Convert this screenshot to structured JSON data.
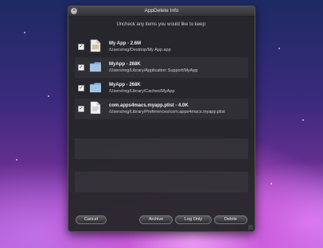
{
  "window": {
    "title": "AppDelete Info",
    "instructions": "Uncheck any items you would like to keep:"
  },
  "items": [
    {
      "name": "My App  -  2.6M",
      "path": "/Users/reg/Desktop/My App.app",
      "checked": "✓",
      "icon": "app-document-icon"
    },
    {
      "name": "MyApp  -  268K",
      "path": "/Users/reg/Library/Application Support/MyApp",
      "checked": "✓",
      "icon": "folder-icon"
    },
    {
      "name": "MyApp  -  268K",
      "path": "/Users/reg/Library/Caches/MyApp",
      "checked": "✓",
      "icon": "folder-icon"
    },
    {
      "name": "com.apps4macs.myapp.plist  -  4.0K",
      "path": "/Users/reg/Library/Preferences/com.apps4macs.myapp.plist",
      "checked": "✓",
      "icon": "plist-document-icon"
    }
  ],
  "buttons": {
    "cancel": "Cancel",
    "archive": "Archive",
    "log_only": "Log Only",
    "delete": "Delete"
  },
  "colors": {
    "folder": "#8fb2d6",
    "document": "#e7e7e7",
    "window_bg": "#26262a"
  }
}
